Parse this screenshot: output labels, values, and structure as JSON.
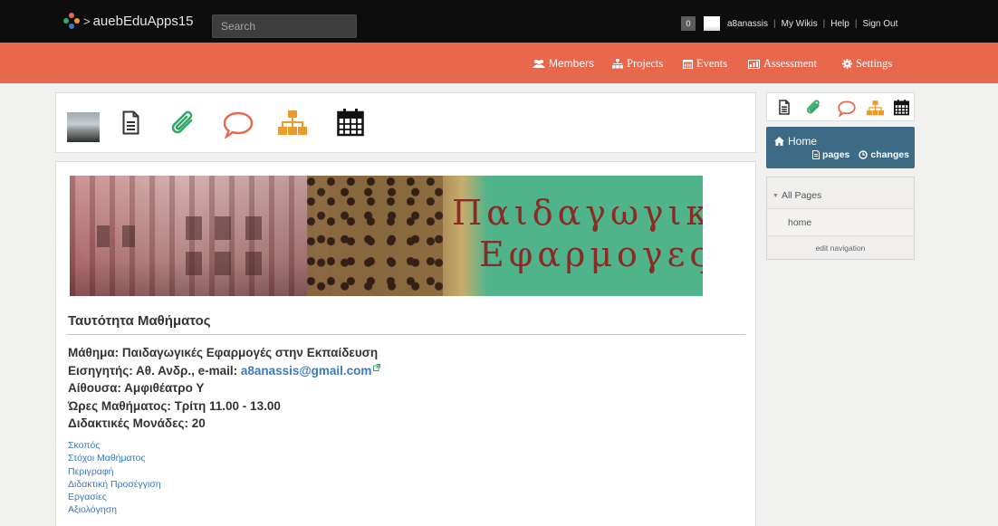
{
  "topbar": {
    "brand": "auebEduApps15",
    "search_placeholder": "Search",
    "notification_count": "0",
    "username": "a8anassis",
    "links": [
      "My Wikis",
      "Help",
      "Sign Out"
    ]
  },
  "navbar": {
    "members": "Members",
    "projects": "Projects",
    "events": "Events",
    "assessment": "Assessment",
    "settings": "Settings"
  },
  "banner": {
    "line1": "Παιδαγωγικες",
    "line2": "Εφαρμογες"
  },
  "content": {
    "section_title": "Ταυτότητα Μαθήματος",
    "course_line": "Μάθημα: Παιδαγωγικές Εφαρμογές στην Εκπαίδευση",
    "instructor_prefix": "Εισηγητής: Αθ. Ανδρ., e-mail: ",
    "instructor_email": "a8anassis@gmail.com",
    "room_line": "Αίθουσα: Αμφιθέατρο Υ",
    "hours_line": "Ώρες Μαθήματος: Τρίτη 11.00 - 13.00",
    "credits_line": "Διδακτικές Μονάδες: 20",
    "toc": [
      "Σκοπός",
      "Στόχοι Μαθήματος",
      "Περιγραφή",
      "Διδακτική Προσέγγιση",
      "Εργασίες",
      "Αξιολόγηση"
    ]
  },
  "sidebar": {
    "home_title": "Home",
    "pages_link": "pages",
    "changes_link": "changes",
    "all_pages": "All Pages",
    "nav_home": "home",
    "edit_navigation": "edit navigation"
  },
  "colors": {
    "topbar": "#0d0d0d",
    "navbar": "#e8684e",
    "home_box": "#3d6a84",
    "link": "#3a77c0",
    "tool_dark": "#333333",
    "tool_green": "#36a66a",
    "tool_orange": "#e8684e",
    "tool_amber": "#eb9a2b"
  },
  "icons": {
    "toolbar": [
      "page-icon",
      "paperclip-icon",
      "comment-icon",
      "sitemap-icon",
      "calendar-icon"
    ]
  }
}
